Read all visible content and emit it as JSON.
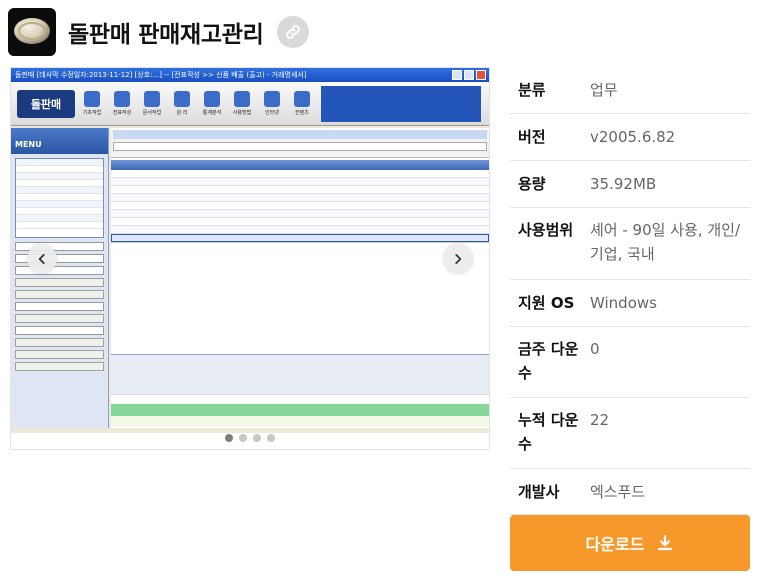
{
  "header": {
    "title": "돌판매 판매재고관리",
    "app_icon": "stone-icon",
    "link_icon": "link-icon"
  },
  "gallery": {
    "screenshot_title": "돌판매 [데사막 수정일자:2013-11-12] [상호:...] -- [전표작성 >> 신품 배출 (출고) - 거래명세서]",
    "screenshot_logo": "돌판매",
    "toolbar": [
      "기초작업",
      "전표작성",
      "문서작업",
      "원 리",
      "통계분석",
      "사용방법",
      "인터넷",
      "컨텐츠"
    ],
    "menu_label": "MENU",
    "slide_count": 4,
    "active_slide": 1
  },
  "info": {
    "rows": [
      {
        "label": "분류",
        "value": "업무"
      },
      {
        "label": "버전",
        "value": "v2005.6.82"
      },
      {
        "label": "용량",
        "value": "35.92MB"
      },
      {
        "label": "사용범위",
        "value": "셰어 - 90일 사용, 개인/기업, 국내"
      },
      {
        "label": "지원 OS",
        "value": "Windows"
      },
      {
        "label": "금주 다운수",
        "value": "0"
      },
      {
        "label": "누적 다운수",
        "value": "22"
      },
      {
        "label": "개발사",
        "value": "엑스푸드"
      }
    ]
  },
  "download": {
    "label": "다운로드",
    "icon": "download-icon"
  },
  "colors": {
    "download_bg": "#f7982a",
    "label_text": "#111111",
    "value_text": "#666666"
  }
}
